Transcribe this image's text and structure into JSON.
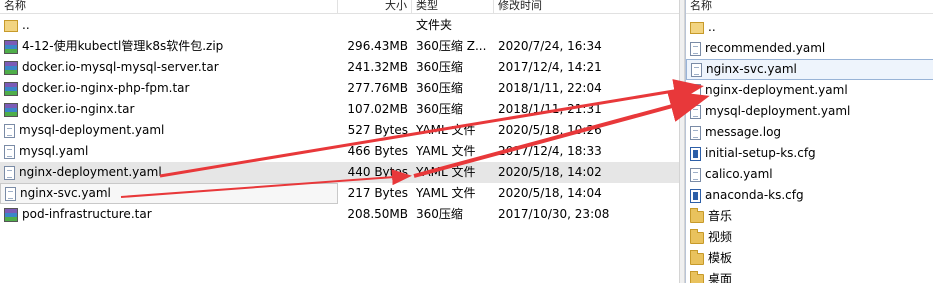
{
  "left_pane": {
    "columns": {
      "name": "名称",
      "size": "大小",
      "type": "类型",
      "date": "修改时间"
    },
    "rows": [
      {
        "icon": "parent-folder-icon",
        "name": "..",
        "size": "",
        "type": "文件夹",
        "date": ""
      },
      {
        "icon": "archive-icon",
        "name": "4-12-使用kubectl管理k8s软件包.zip",
        "size": "296.43MB",
        "type": "360压缩 Z...",
        "date": "2020/7/24, 16:34"
      },
      {
        "icon": "archive-icon",
        "name": "docker.io-mysql-mysql-server.tar",
        "size": "241.32MB",
        "type": "360压缩",
        "date": "2017/12/4, 14:21"
      },
      {
        "icon": "archive-icon",
        "name": "docker.io-nginx-php-fpm.tar",
        "size": "277.76MB",
        "type": "360压缩",
        "date": "2018/1/11, 22:04"
      },
      {
        "icon": "archive-icon",
        "name": "docker.io-nginx.tar",
        "size": "107.02MB",
        "type": "360压缩",
        "date": "2018/1/11, 21:31"
      },
      {
        "icon": "yaml-file-icon",
        "name": "mysql-deployment.yaml",
        "size": "527 Bytes",
        "type": "YAML 文件",
        "date": "2020/5/18, 10:26"
      },
      {
        "icon": "yaml-file-icon",
        "name": "mysql.yaml",
        "size": "466 Bytes",
        "type": "YAML 文件",
        "date": "2017/12/4, 18:33"
      },
      {
        "icon": "yaml-file-icon",
        "name": "nginx-deployment.yaml",
        "size": "440 Bytes",
        "type": "YAML 文件",
        "date": "2020/5/18, 14:02"
      },
      {
        "icon": "yaml-file-icon",
        "name": "nginx-svc.yaml",
        "size": "217 Bytes",
        "type": "YAML 文件",
        "date": "2020/5/18, 14:04"
      },
      {
        "icon": "archive-icon",
        "name": "pod-infrastructure.tar",
        "size": "208.50MB",
        "type": "360压缩",
        "date": "2017/10/30, 23:08"
      }
    ]
  },
  "right_pane": {
    "columns": {
      "name": "名称"
    },
    "rows": [
      {
        "icon": "parent-folder-icon",
        "name": ".."
      },
      {
        "icon": "yaml-file-icon",
        "name": "recommended.yaml"
      },
      {
        "icon": "yaml-file-icon",
        "name": "nginx-svc.yaml"
      },
      {
        "icon": "yaml-file-icon",
        "name": "nginx-deployment.yaml"
      },
      {
        "icon": "yaml-file-icon",
        "name": "mysql-deployment.yaml"
      },
      {
        "icon": "text-file-icon",
        "name": "message.log"
      },
      {
        "icon": "config-file-icon",
        "name": "initial-setup-ks.cfg"
      },
      {
        "icon": "yaml-file-icon",
        "name": "calico.yaml"
      },
      {
        "icon": "config-file-icon",
        "name": "anaconda-ks.cfg"
      },
      {
        "icon": "folder-icon",
        "name": "音乐"
      },
      {
        "icon": "folder-icon",
        "name": "视频"
      },
      {
        "icon": "folder-icon",
        "name": "模板"
      },
      {
        "icon": "folder-icon",
        "name": "桌面"
      }
    ]
  },
  "annotation_color": "#e8383a"
}
